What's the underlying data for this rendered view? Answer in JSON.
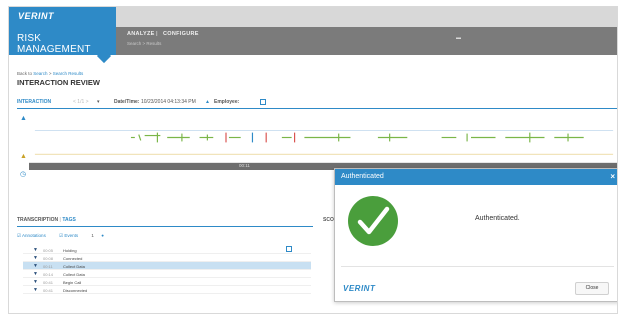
{
  "brand": {
    "logo": "VERINT",
    "app_title": "RISK MANAGEMENT",
    "accent": "#2e8ac7"
  },
  "nav": {
    "tabs": [
      "ANALYZE",
      "CONFIGURE"
    ],
    "sub": "Search  >  Results"
  },
  "breadcrumb": {
    "prefix": "Back to",
    "link1": "Search",
    "sep": ">",
    "link2": "Search Results"
  },
  "page_title": "INTERACTION REVIEW",
  "toolbar": {
    "tab": "INTERACTION",
    "date_label": "Date/Time:",
    "date_value": "10/23/2014 04:13:34 PM",
    "employee_label": "Employee:"
  },
  "timeline": {
    "label": "00:11"
  },
  "section": {
    "tab1": "TRANSCRIPTION",
    "tab2": "TAGS",
    "score_label": "SCO",
    "filters": [
      "Annotations",
      "Events"
    ],
    "count": "1"
  },
  "events": [
    {
      "time": "00:05",
      "label": "Holding"
    },
    {
      "time": "00:08",
      "label": "Connected"
    },
    {
      "time": "00:11",
      "label": "Collect Data",
      "selected": true
    },
    {
      "time": "00:14",
      "label": "Collect Data"
    },
    {
      "time": "00:41",
      "label": "Begin Call"
    },
    {
      "time": "00:41",
      "label": "Disconnected"
    }
  ],
  "modal": {
    "title": "Authenticated",
    "message": "Authenticated.",
    "logo": "VERINT",
    "close_label": "Close",
    "check_color": "#4a9e3c"
  }
}
